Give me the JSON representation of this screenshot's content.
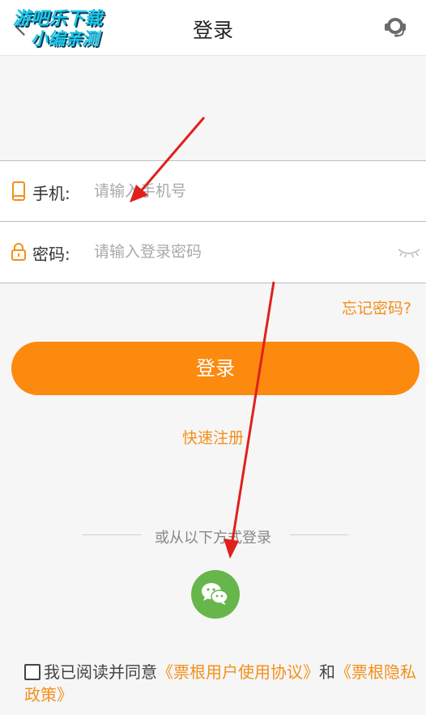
{
  "header": {
    "title": "登录",
    "watermark_line1": "游吧乐下载",
    "watermark_line2": "小编亲测"
  },
  "form": {
    "phone_label": "手机:",
    "phone_placeholder": "请输入手机号",
    "password_label": "密码:",
    "password_placeholder": "请输入登录密码"
  },
  "forgot_password": "忘记密码?",
  "login_button": "登录",
  "register_link": "快速注册",
  "alt_login_text": "或从以下方式登录",
  "agreement": {
    "prefix": "我已阅读并同意",
    "user_agreement": "《票根用户使用协议》",
    "and": "和",
    "privacy_policy": "《票根隐私政策》"
  },
  "colors": {
    "accent": "#fb8a0f",
    "link": "#f3901c",
    "wechat": "#67b64b",
    "annotation_arrow": "#e0201b"
  },
  "icons": [
    "back-icon",
    "headset-icon",
    "phone-icon",
    "lock-icon",
    "eye-closed-icon",
    "wechat-icon",
    "checkbox-icon"
  ]
}
